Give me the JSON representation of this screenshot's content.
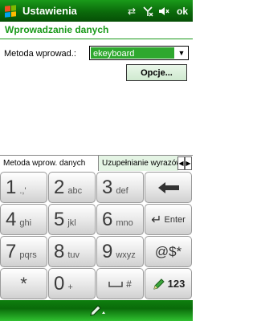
{
  "titlebar": {
    "title": "Ustawienia",
    "ok_label": "ok",
    "icons": [
      "connectivity-icon",
      "signal-off-icon",
      "volume-muted-icon"
    ],
    "accent": "#0b6a0b"
  },
  "page": {
    "heading": "Wprowadzanie danych",
    "heading_color": "#1a9a1a"
  },
  "form": {
    "method_label": "Metoda wprowad.:",
    "method_value": "ekeyboard",
    "options_label": "Opcje..."
  },
  "tabs": [
    {
      "label": "Metoda wprow. danych",
      "active": true
    },
    {
      "label": "Uzupełnianie wyrazów",
      "active": false
    }
  ],
  "keypad": {
    "keys": [
      {
        "num": "1",
        "sub": ".,'"
      },
      {
        "num": "2",
        "sub": "abc"
      },
      {
        "num": "3",
        "sub": "def"
      },
      {
        "num": "←",
        "sub": ""
      },
      {
        "num": "4",
        "sub": "ghi"
      },
      {
        "num": "5",
        "sub": "jkl"
      },
      {
        "num": "6",
        "sub": "mno"
      },
      {
        "num": "↵",
        "sub": "Enter"
      },
      {
        "num": "7",
        "sub": "pqrs"
      },
      {
        "num": "8",
        "sub": "tuv"
      },
      {
        "num": "9",
        "sub": "wxyz"
      },
      {
        "num": "@$*",
        "sub": ""
      },
      {
        "num": "*",
        "sub": ""
      },
      {
        "num": "0",
        "sub": "+"
      },
      {
        "num": "⌴",
        "sub": "#"
      },
      {
        "num": "",
        "sub": "123"
      }
    ]
  }
}
